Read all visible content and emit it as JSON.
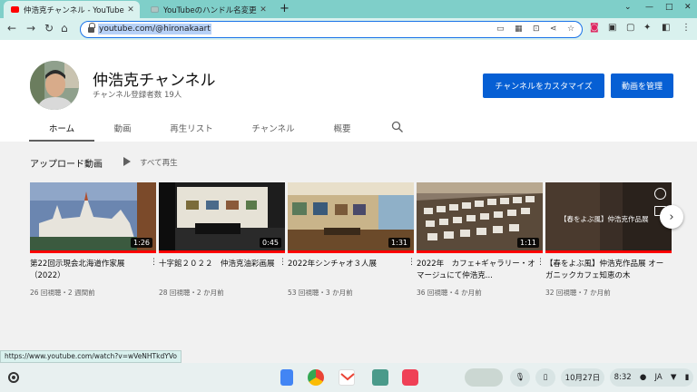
{
  "browser": {
    "tabs": [
      {
        "title": "仲浩克チャンネル - YouTube",
        "active": true
      },
      {
        "title": "YouTubeのハンドル名変更しよう",
        "active": false
      }
    ],
    "new_tab": "+",
    "url": "youtube.com/@hironakaart"
  },
  "channel": {
    "name": "仲浩克チャンネル",
    "subscribers": "チャンネル登録者数 19人",
    "customize_button": "チャンネルをカスタマイズ",
    "manage_button": "動画を管理",
    "tabs": [
      "ホーム",
      "動画",
      "再生リスト",
      "チャンネル",
      "概要"
    ],
    "active_tab": "ホーム"
  },
  "section": {
    "title": "アップロード動画",
    "play_all": "すべて再生"
  },
  "videos": [
    {
      "title": "第22回示現会北海道作家展（2022）",
      "duration": "1:26",
      "meta": "26 回視聴・2 週間前"
    },
    {
      "title": "十字館２０２２　仲浩克油彩画展",
      "duration": "0:45",
      "meta": "28 回視聴・2 か月前"
    },
    {
      "title": "2022年シンチャオ３人展",
      "duration": "1:31",
      "meta": "53 回視聴・3 か月前"
    },
    {
      "title": "2022年　カフェ+ギャラリー・オマージュにて仲浩克...",
      "duration": "1:11",
      "meta": "36 回視聴・4 か月前"
    },
    {
      "title": "【春をよぶ風】仲浩克作品展 オーガニックカフェ知恵の木",
      "duration": "",
      "meta": "32 回視聴・7 か月前",
      "thumb_text": "【春をよぶ風】仲浩克作品展"
    }
  ],
  "status_link": "https://www.youtube.com/watch?v=wVeNHTkdYVo",
  "shelf": {
    "date": "10月27日",
    "time": "8:32",
    "ime": "JA"
  },
  "colors": {
    "tabstrip": "#7fcfc9",
    "toolbar": "#d9f1ee",
    "yt_blue_button": "#065fd4",
    "progress_red": "#ff0000"
  }
}
